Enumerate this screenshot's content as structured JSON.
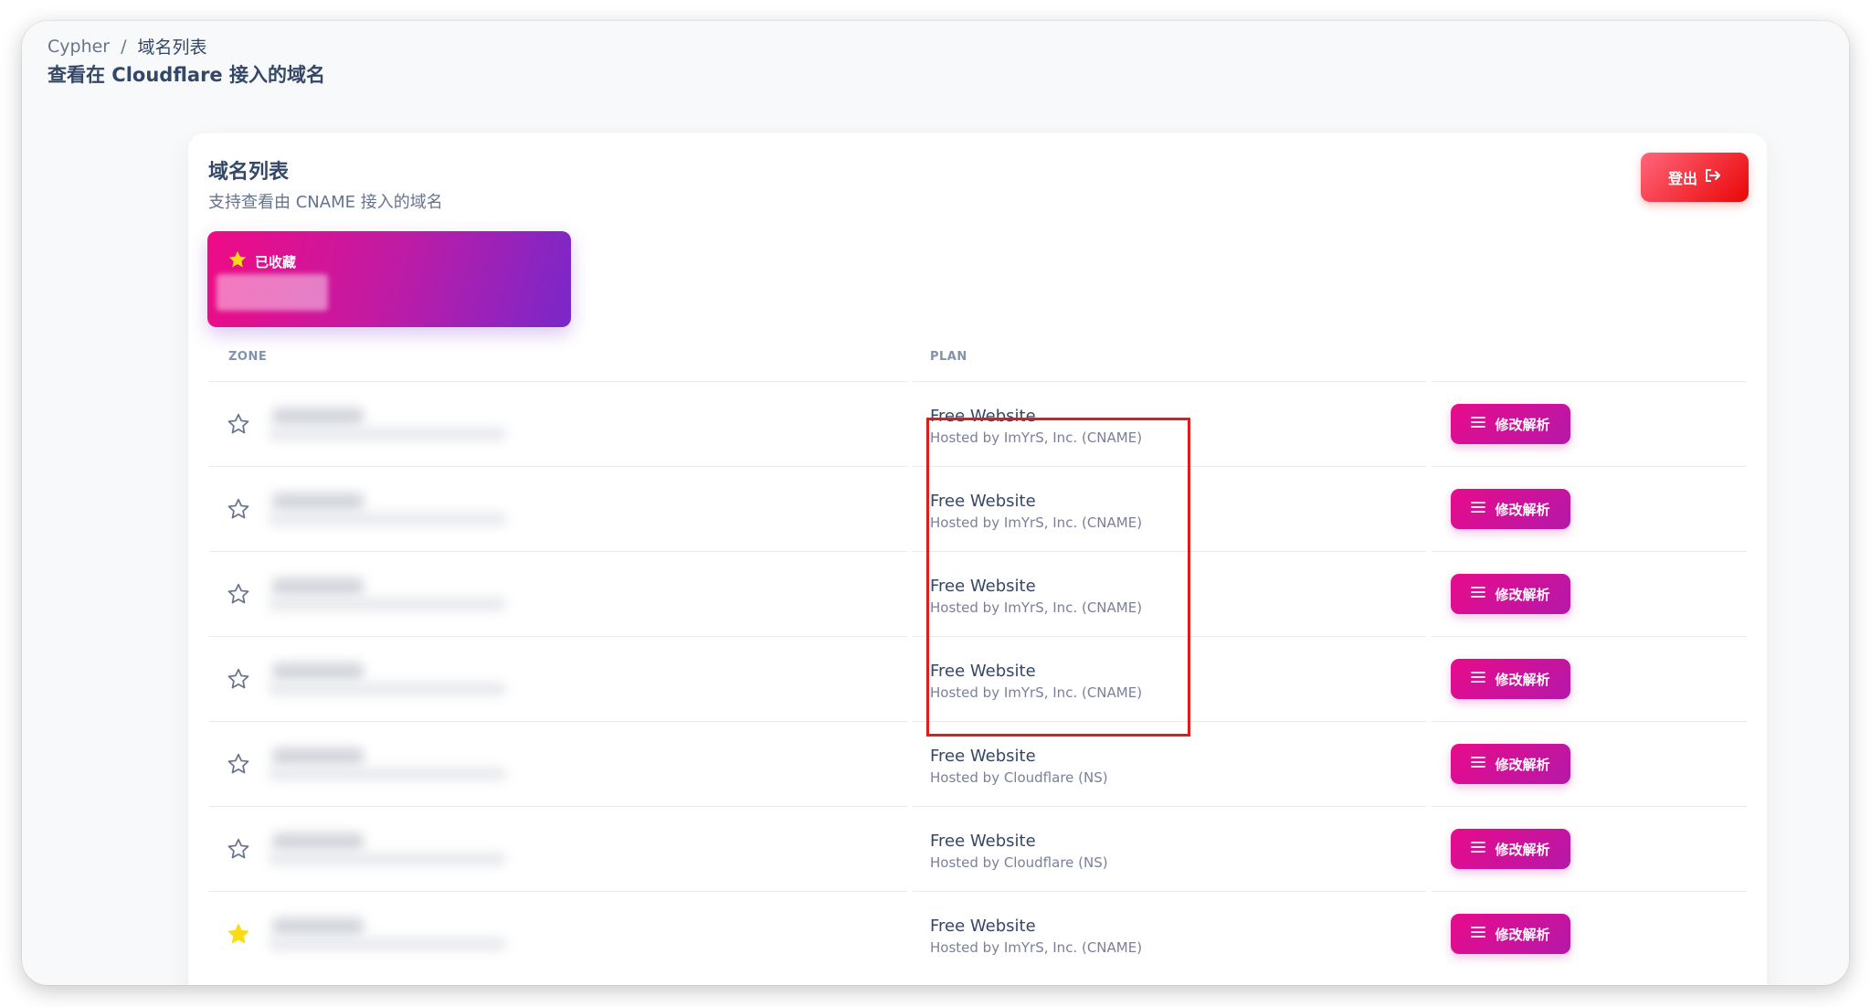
{
  "breadcrumb": {
    "root": "Cypher",
    "separator": "/",
    "current": "域名列表"
  },
  "page_title": "查看在 Cloudflare 接入的域名",
  "card": {
    "title": "域名列表",
    "subtitle": "支持查看由 CNAME 接入的域名",
    "logout_label": "登出",
    "logout_icon": "logout-icon"
  },
  "favorites": {
    "label": "已收藏",
    "icon": "star-filled-icon"
  },
  "table": {
    "columns": {
      "zone": "ZONE",
      "plan": "PLAN"
    },
    "edit_label": "修改解析",
    "edit_icon": "menu-icon",
    "rows": [
      {
        "starred": false,
        "plan_name": "Free Website",
        "plan_host": "Hosted by ImYrS, Inc. (CNAME)"
      },
      {
        "starred": false,
        "plan_name": "Free Website",
        "plan_host": "Hosted by ImYrS, Inc. (CNAME)"
      },
      {
        "starred": false,
        "plan_name": "Free Website",
        "plan_host": "Hosted by ImYrS, Inc. (CNAME)"
      },
      {
        "starred": false,
        "plan_name": "Free Website",
        "plan_host": "Hosted by ImYrS, Inc. (CNAME)"
      },
      {
        "starred": false,
        "plan_name": "Free Website",
        "plan_host": "Hosted by Cloudflare (NS)"
      },
      {
        "starred": false,
        "plan_name": "Free Website",
        "plan_host": "Hosted by Cloudflare (NS)"
      },
      {
        "starred": true,
        "plan_name": "Free Website",
        "plan_host": "Hosted by ImYrS, Inc. (CNAME)"
      }
    ]
  },
  "colors": {
    "star_filled": "#fadb14",
    "primary_gradient_start": "#e80b8b",
    "primary_gradient_end": "#7928ca",
    "danger": "#ea0606",
    "highlight_box": "#e01b1b"
  }
}
